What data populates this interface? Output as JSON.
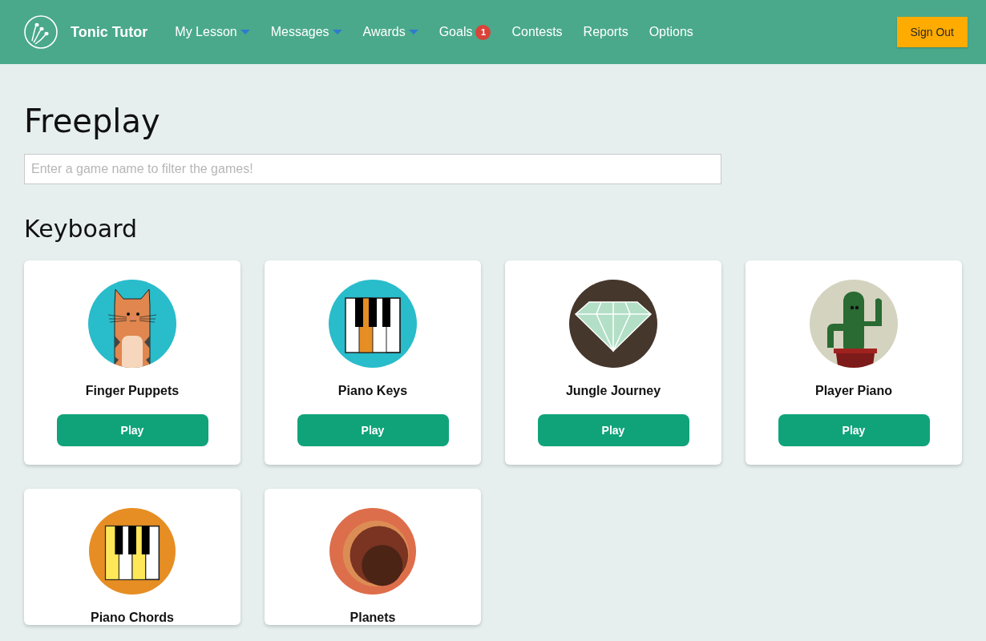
{
  "brand": {
    "name": "Tonic Tutor"
  },
  "nav": [
    {
      "label": "My Lesson",
      "dropdown": true
    },
    {
      "label": "Messages",
      "dropdown": true
    },
    {
      "label": "Awards",
      "dropdown": true
    },
    {
      "label": "Goals",
      "dropdown": false,
      "badge": "1"
    },
    {
      "label": "Contests",
      "dropdown": false
    },
    {
      "label": "Reports",
      "dropdown": false
    },
    {
      "label": "Options",
      "dropdown": false
    }
  ],
  "sign_out": "Sign Out",
  "title": "Freeplay",
  "search": {
    "placeholder": "Enter a game name to filter the games!"
  },
  "section": "Keyboard",
  "games": [
    {
      "name": "Finger Puppets",
      "kind": "cat",
      "button": "Play"
    },
    {
      "name": "Piano Keys",
      "kind": "piano-keys",
      "button": "Play"
    },
    {
      "name": "Jungle Journey",
      "kind": "diamond",
      "button": "Play"
    },
    {
      "name": "Player Piano",
      "kind": "cactus",
      "button": "Play"
    },
    {
      "name": "Piano Chords",
      "kind": "piano-chords"
    },
    {
      "name": "Planets",
      "kind": "planets"
    }
  ]
}
